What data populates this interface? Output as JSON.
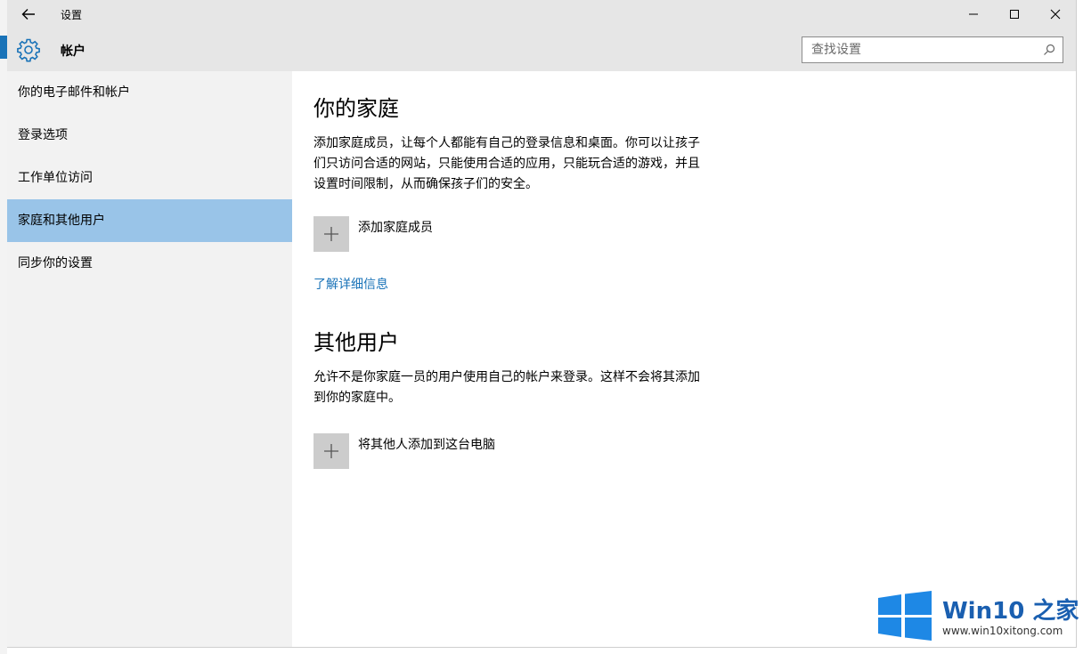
{
  "window": {
    "title": "设置"
  },
  "header": {
    "section_title": "帐户",
    "search_placeholder": "查找设置"
  },
  "sidebar": {
    "items": [
      {
        "label": "你的电子邮件和帐户",
        "selected": false
      },
      {
        "label": "登录选项",
        "selected": false
      },
      {
        "label": "工作单位访问",
        "selected": false
      },
      {
        "label": "家庭和其他用户",
        "selected": true
      },
      {
        "label": "同步你的设置",
        "selected": false
      }
    ]
  },
  "main": {
    "family": {
      "heading": "你的家庭",
      "description": "添加家庭成员，让每个人都能有自己的登录信息和桌面。你可以让孩子们只访问合适的网站，只能使用合适的应用，只能玩合适的游戏，并且设置时间限制，从而确保孩子们的安全。",
      "add_label": "添加家庭成员",
      "learn_more": "了解详细信息"
    },
    "others": {
      "heading": "其他用户",
      "description": "允许不是你家庭一员的用户使用自己的帐户来登录。这样不会将其添加到你的家庭中。",
      "add_label": "将其他人添加到这台电脑"
    }
  },
  "watermark": {
    "title": "Win10 之家",
    "url": "www.win10xitong.com"
  },
  "colors": {
    "accent": "#1a73b8",
    "selected": "#99c4e8",
    "sidebar": "#f2f2f2",
    "header": "#e6e6e6"
  }
}
